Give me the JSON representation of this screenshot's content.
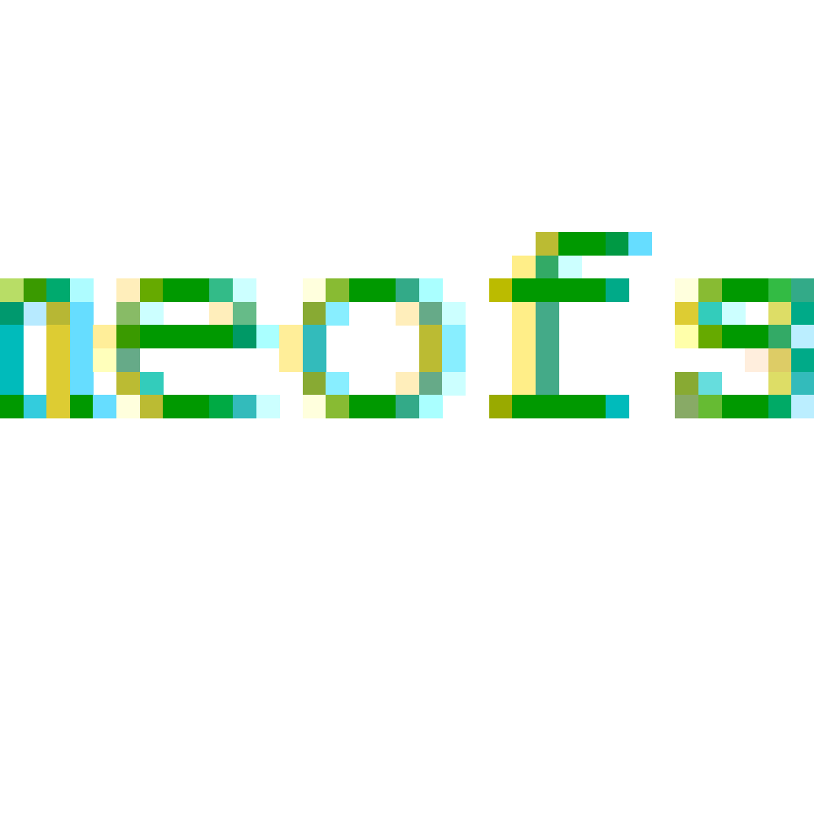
{
  "logo": {
    "text": "neofs",
    "cells": [
      {
        "c": 0,
        "r": 2,
        "color": "#b8dd66"
      },
      {
        "c": 1,
        "r": 2,
        "color": "#3a9a00"
      },
      {
        "c": 2,
        "r": 2,
        "color": "#00aa6e"
      },
      {
        "c": 3,
        "r": 2,
        "color": "#aefcff"
      },
      {
        "c": 0,
        "r": 3,
        "color": "#00996e"
      },
      {
        "c": 1,
        "r": 3,
        "color": "#b7eaff"
      },
      {
        "c": 2,
        "r": 3,
        "color": "#b7b734"
      },
      {
        "c": 3,
        "r": 3,
        "color": "#66ddff"
      },
      {
        "c": 0,
        "r": 4,
        "color": "#00bbbb"
      },
      {
        "c": 2,
        "r": 4,
        "color": "#ddcc33"
      },
      {
        "c": 3,
        "r": 4,
        "color": "#66ddff"
      },
      {
        "c": 0,
        "r": 5,
        "color": "#00bbbb"
      },
      {
        "c": 2,
        "r": 5,
        "color": "#ddcc33"
      },
      {
        "c": 3,
        "r": 5,
        "color": "#66ddff"
      },
      {
        "c": 0,
        "r": 6,
        "color": "#00bbbb"
      },
      {
        "c": 2,
        "r": 6,
        "color": "#ddcc33"
      },
      {
        "c": 3,
        "r": 6,
        "color": "#66ddff"
      },
      {
        "c": 0,
        "r": 7,
        "color": "#009900"
      },
      {
        "c": 1,
        "r": 7,
        "color": "#33ccdd"
      },
      {
        "c": 2,
        "r": 7,
        "color": "#ddcc33"
      },
      {
        "c": 3,
        "r": 7,
        "color": "#009900"
      },
      {
        "c": 5,
        "r": 2,
        "color": "#ffeebb"
      },
      {
        "c": 6,
        "r": 2,
        "color": "#66aa00"
      },
      {
        "c": 7,
        "r": 2,
        "color": "#009900"
      },
      {
        "c": 8,
        "r": 2,
        "color": "#009900"
      },
      {
        "c": 9,
        "r": 2,
        "color": "#33bb88"
      },
      {
        "c": 10,
        "r": 2,
        "color": "#ccffff"
      },
      {
        "c": 5,
        "r": 3,
        "color": "#88bb66"
      },
      {
        "c": 6,
        "r": 3,
        "color": "#ccffff"
      },
      {
        "c": 9,
        "r": 3,
        "color": "#ffeebb"
      },
      {
        "c": 10,
        "r": 3,
        "color": "#66bb88"
      },
      {
        "c": 4,
        "r": 4,
        "color": "#ffee99"
      },
      {
        "c": 5,
        "r": 4,
        "color": "#3a9a00"
      },
      {
        "c": 6,
        "r": 4,
        "color": "#009900"
      },
      {
        "c": 7,
        "r": 4,
        "color": "#009900"
      },
      {
        "c": 8,
        "r": 4,
        "color": "#009900"
      },
      {
        "c": 9,
        "r": 4,
        "color": "#009900"
      },
      {
        "c": 10,
        "r": 4,
        "color": "#009966"
      },
      {
        "c": 11,
        "r": 4,
        "color": "#aaffff"
      },
      {
        "c": 4,
        "r": 5,
        "color": "#ffffbb"
      },
      {
        "c": 5,
        "r": 5,
        "color": "#66aa88"
      },
      {
        "c": 5,
        "r": 6,
        "color": "#bbbb33"
      },
      {
        "c": 6,
        "r": 6,
        "color": "#33ccbb"
      },
      {
        "c": 4,
        "r": 7,
        "color": "#66ddff"
      },
      {
        "c": 5,
        "r": 7,
        "color": "#ffffdd"
      },
      {
        "c": 6,
        "r": 7,
        "color": "#bbbb33"
      },
      {
        "c": 7,
        "r": 7,
        "color": "#009900"
      },
      {
        "c": 8,
        "r": 7,
        "color": "#009900"
      },
      {
        "c": 9,
        "r": 7,
        "color": "#00aa44"
      },
      {
        "c": 10,
        "r": 7,
        "color": "#33bbbb"
      },
      {
        "c": 11,
        "r": 7,
        "color": "#ccffff"
      },
      {
        "c": 13,
        "r": 2,
        "color": "#ffffdd"
      },
      {
        "c": 14,
        "r": 2,
        "color": "#88bb33"
      },
      {
        "c": 15,
        "r": 2,
        "color": "#009900"
      },
      {
        "c": 16,
        "r": 2,
        "color": "#009900"
      },
      {
        "c": 17,
        "r": 2,
        "color": "#33aa88"
      },
      {
        "c": 18,
        "r": 2,
        "color": "#aaffff"
      },
      {
        "c": 13,
        "r": 3,
        "color": "#88aa33"
      },
      {
        "c": 14,
        "r": 3,
        "color": "#88eeff"
      },
      {
        "c": 17,
        "r": 3,
        "color": "#ffeebb"
      },
      {
        "c": 18,
        "r": 3,
        "color": "#66aa88"
      },
      {
        "c": 19,
        "r": 3,
        "color": "#ccffff"
      },
      {
        "c": 12,
        "r": 4,
        "color": "#ffee99"
      },
      {
        "c": 13,
        "r": 4,
        "color": "#33bbbb"
      },
      {
        "c": 18,
        "r": 4,
        "color": "#bbbb33"
      },
      {
        "c": 19,
        "r": 4,
        "color": "#88eeff"
      },
      {
        "c": 12,
        "r": 5,
        "color": "#ffee99"
      },
      {
        "c": 13,
        "r": 5,
        "color": "#33bbbb"
      },
      {
        "c": 18,
        "r": 5,
        "color": "#bbbb33"
      },
      {
        "c": 19,
        "r": 5,
        "color": "#88eeff"
      },
      {
        "c": 13,
        "r": 6,
        "color": "#88aa33"
      },
      {
        "c": 14,
        "r": 6,
        "color": "#88eeff"
      },
      {
        "c": 17,
        "r": 6,
        "color": "#ffeebb"
      },
      {
        "c": 18,
        "r": 6,
        "color": "#66aa88"
      },
      {
        "c": 19,
        "r": 6,
        "color": "#ccffff"
      },
      {
        "c": 13,
        "r": 7,
        "color": "#ffffdd"
      },
      {
        "c": 14,
        "r": 7,
        "color": "#88bb33"
      },
      {
        "c": 15,
        "r": 7,
        "color": "#009900"
      },
      {
        "c": 16,
        "r": 7,
        "color": "#009900"
      },
      {
        "c": 17,
        "r": 7,
        "color": "#33aa88"
      },
      {
        "c": 18,
        "r": 7,
        "color": "#aaffff"
      },
      {
        "c": 23,
        "r": 0,
        "color": "#bbbb33"
      },
      {
        "c": 24,
        "r": 0,
        "color": "#009900"
      },
      {
        "c": 25,
        "r": 0,
        "color": "#009900"
      },
      {
        "c": 26,
        "r": 0,
        "color": "#009944"
      },
      {
        "c": 27,
        "r": 0,
        "color": "#66ddff"
      },
      {
        "c": 22,
        "r": 1,
        "color": "#ffee88"
      },
      {
        "c": 23,
        "r": 1,
        "color": "#33aa66"
      },
      {
        "c": 24,
        "r": 1,
        "color": "#ccffff"
      },
      {
        "c": 21,
        "r": 2,
        "color": "#bbbb00"
      },
      {
        "c": 22,
        "r": 2,
        "color": "#009900"
      },
      {
        "c": 23,
        "r": 2,
        "color": "#009900"
      },
      {
        "c": 24,
        "r": 2,
        "color": "#009900"
      },
      {
        "c": 25,
        "r": 2,
        "color": "#009900"
      },
      {
        "c": 26,
        "r": 2,
        "color": "#00aa88"
      },
      {
        "c": 22,
        "r": 3,
        "color": "#ffee88"
      },
      {
        "c": 23,
        "r": 3,
        "color": "#44aa88"
      },
      {
        "c": 22,
        "r": 4,
        "color": "#ffee88"
      },
      {
        "c": 23,
        "r": 4,
        "color": "#44aa88"
      },
      {
        "c": 22,
        "r": 5,
        "color": "#ffee88"
      },
      {
        "c": 23,
        "r": 5,
        "color": "#44aa88"
      },
      {
        "c": 22,
        "r": 6,
        "color": "#ffee88"
      },
      {
        "c": 23,
        "r": 6,
        "color": "#44aa88"
      },
      {
        "c": 21,
        "r": 7,
        "color": "#99aa00"
      },
      {
        "c": 22,
        "r": 7,
        "color": "#009900"
      },
      {
        "c": 23,
        "r": 7,
        "color": "#009900"
      },
      {
        "c": 24,
        "r": 7,
        "color": "#009900"
      },
      {
        "c": 25,
        "r": 7,
        "color": "#009900"
      },
      {
        "c": 26,
        "r": 7,
        "color": "#00bbbb"
      },
      {
        "c": 29,
        "r": 2,
        "color": "#ffffdd"
      },
      {
        "c": 30,
        "r": 2,
        "color": "#88bb33"
      },
      {
        "c": 31,
        "r": 2,
        "color": "#009900"
      },
      {
        "c": 32,
        "r": 2,
        "color": "#009900"
      },
      {
        "c": 33,
        "r": 2,
        "color": "#33bb44"
      },
      {
        "c": 34,
        "r": 2,
        "color": "#33aa88"
      },
      {
        "c": 29,
        "r": 3,
        "color": "#ddcc33"
      },
      {
        "c": 30,
        "r": 3,
        "color": "#33ccbb"
      },
      {
        "c": 31,
        "r": 3,
        "color": "#ccffff"
      },
      {
        "c": 33,
        "r": 3,
        "color": "#dddd66"
      },
      {
        "c": 34,
        "r": 3,
        "color": "#00aa88"
      },
      {
        "c": 29,
        "r": 4,
        "color": "#ffffaa"
      },
      {
        "c": 30,
        "r": 4,
        "color": "#66aa00"
      },
      {
        "c": 31,
        "r": 4,
        "color": "#009900"
      },
      {
        "c": 32,
        "r": 4,
        "color": "#009900"
      },
      {
        "c": 33,
        "r": 4,
        "color": "#33aa66"
      },
      {
        "c": 34,
        "r": 4,
        "color": "#bbeeff"
      },
      {
        "c": 32,
        "r": 5,
        "color": "#ffeedd"
      },
      {
        "c": 33,
        "r": 5,
        "color": "#ddcc66"
      },
      {
        "c": 34,
        "r": 5,
        "color": "#00aa88"
      },
      {
        "c": 29,
        "r": 6,
        "color": "#88aa33"
      },
      {
        "c": 30,
        "r": 6,
        "color": "#66dddd"
      },
      {
        "c": 33,
        "r": 6,
        "color": "#dddd66"
      },
      {
        "c": 34,
        "r": 6,
        "color": "#33bbbb"
      },
      {
        "c": 29,
        "r": 7,
        "color": "#88aa66"
      },
      {
        "c": 30,
        "r": 7,
        "color": "#66bb33"
      },
      {
        "c": 31,
        "r": 7,
        "color": "#009900"
      },
      {
        "c": 32,
        "r": 7,
        "color": "#009900"
      },
      {
        "c": 33,
        "r": 7,
        "color": "#00aa66"
      },
      {
        "c": 34,
        "r": 7,
        "color": "#bbeeff"
      }
    ]
  }
}
